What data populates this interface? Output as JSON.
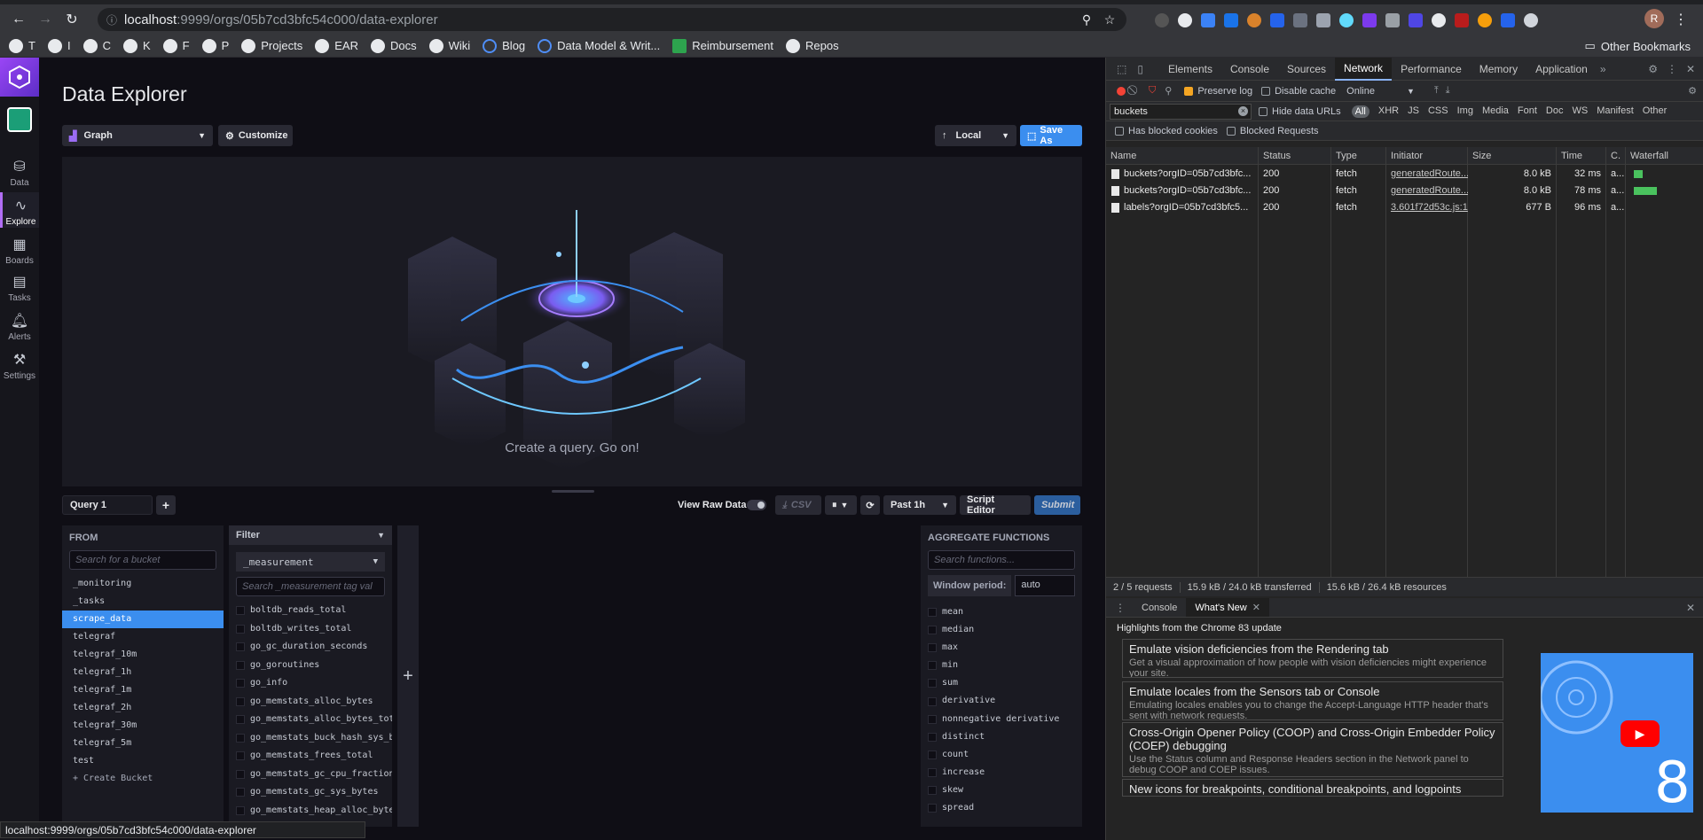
{
  "browser": {
    "url_host": "localhost",
    "url_path": ":9999/orgs/05b7cd3bfc54c000/data-explorer",
    "bookmarks": [
      {
        "label": "T",
        "icon": "github-icon"
      },
      {
        "label": "I",
        "icon": "github-icon"
      },
      {
        "label": "C",
        "icon": "github-icon"
      },
      {
        "label": "K",
        "icon": "github-icon"
      },
      {
        "label": "F",
        "icon": "github-icon"
      },
      {
        "label": "P",
        "icon": "github-icon"
      },
      {
        "label": "Projects",
        "icon": "github-icon"
      },
      {
        "label": "EAR",
        "icon": "github-icon"
      },
      {
        "label": "Docs",
        "icon": "github-icon"
      },
      {
        "label": "Wiki",
        "icon": "wiki-icon"
      },
      {
        "label": "Blog",
        "icon": "globe-icon"
      },
      {
        "label": "Data Model & Writ...",
        "icon": "globe-icon"
      },
      {
        "label": "Reimbursement",
        "icon": "expense-icon"
      },
      {
        "label": "Repos",
        "icon": "github-icon"
      }
    ],
    "other_bookmarks": "Other Bookmarks",
    "profile_initial": "R",
    "status_url": "localhost:9999/orgs/05b7cd3bfc54c000/data-explorer"
  },
  "nav": {
    "items": [
      {
        "label": "Data",
        "icon": "database-icon"
      },
      {
        "label": "Explore",
        "icon": "graph-icon"
      },
      {
        "label": "Boards",
        "icon": "dashboard-icon"
      },
      {
        "label": "Tasks",
        "icon": "calendar-icon"
      },
      {
        "label": "Alerts",
        "icon": "bell-icon"
      },
      {
        "label": "Settings",
        "icon": "wrench-icon"
      }
    ]
  },
  "page": {
    "title": "Data Explorer",
    "graph_type": "Graph",
    "customize": "Customize",
    "timezone": "Local",
    "save_as": "Save As",
    "empty_message": "Create a query. Go on!"
  },
  "query": {
    "tab": "Query 1",
    "add": "+",
    "view_raw": "View Raw Data",
    "csv": "CSV",
    "time_range": "Past 1h",
    "script_editor": "Script Editor",
    "submit": "Submit"
  },
  "from": {
    "header": "FROM",
    "search_placeholder": "Search for a bucket",
    "buckets": [
      "_monitoring",
      "_tasks",
      "scrape_data",
      "telegraf",
      "telegraf_10m",
      "telegraf_1h",
      "telegraf_1m",
      "telegraf_2h",
      "telegraf_30m",
      "telegraf_5m",
      "test"
    ],
    "selected": "scrape_data",
    "create": "+ Create Bucket"
  },
  "filter": {
    "header": "Filter",
    "key": "_measurement",
    "search_placeholder": "Search _measurement tag val",
    "values": [
      "boltdb_reads_total",
      "boltdb_writes_total",
      "go_gc_duration_seconds",
      "go_goroutines",
      "go_info",
      "go_memstats_alloc_bytes",
      "go_memstats_alloc_bytes_total",
      "go_memstats_buck_hash_sys_bytes",
      "go_memstats_frees_total",
      "go_memstats_gc_cpu_fraction",
      "go_memstats_gc_sys_bytes",
      "go_memstats_heap_alloc_bytes"
    ],
    "add": "+"
  },
  "aggregate": {
    "header": "AGGREGATE FUNCTIONS",
    "search_placeholder": "Search functions...",
    "window_label": "Window period:",
    "window_value": "auto",
    "functions": [
      "mean",
      "median",
      "max",
      "min",
      "sum",
      "derivative",
      "nonnegative derivative",
      "distinct",
      "count",
      "increase",
      "skew",
      "spread"
    ]
  },
  "devtools": {
    "tabs": [
      "Elements",
      "Console",
      "Sources",
      "Network",
      "Performance",
      "Memory",
      "Application"
    ],
    "active_tab": "Network",
    "preserve_log": "Preserve log",
    "disable_cache": "Disable cache",
    "throttle": "Online",
    "filter_value": "buckets",
    "hide_data_urls": "Hide data URLs",
    "types": [
      "All",
      "XHR",
      "JS",
      "CSS",
      "Img",
      "Media",
      "Font",
      "Doc",
      "WS",
      "Manifest",
      "Other"
    ],
    "has_blocked": "Has blocked cookies",
    "blocked_requests": "Blocked Requests",
    "columns": [
      "Name",
      "Status",
      "Type",
      "Initiator",
      "Size",
      "Time",
      "C.",
      "Waterfall"
    ],
    "rows": [
      {
        "name": "buckets?orgID=05b7cd3bfc...",
        "status": "200",
        "type": "fetch",
        "initiator": "generatedRoute...",
        "size": "8.0 kB",
        "time": "32 ms",
        "c": "a..."
      },
      {
        "name": "buckets?orgID=05b7cd3bfc...",
        "status": "200",
        "type": "fetch",
        "initiator": "generatedRoute...",
        "size": "8.0 kB",
        "time": "78 ms",
        "c": "a..."
      },
      {
        "name": "labels?orgID=05b7cd3bfc5...",
        "status": "200",
        "type": "fetch",
        "initiator": "3.601f72d53c.js:1",
        "size": "677 B",
        "time": "96 ms",
        "c": "a..."
      }
    ],
    "summary": [
      "2 / 5 requests",
      "15.9 kB / 24.0 kB transferred",
      "15.6 kB / 26.4 kB resources"
    ],
    "drawer_tabs": [
      "Console",
      "What's New"
    ],
    "whats_new_title": "Highlights from the Chrome 83 update",
    "whats_new": [
      {
        "title": "Emulate vision deficiencies from the Rendering tab",
        "desc": "Get a visual approximation of how people with vision deficiencies might experience your site."
      },
      {
        "title": "Emulate locales from the Sensors tab or Console",
        "desc": "Emulating locales enables you to change the Accept-Language HTTP header that's sent with network requests."
      },
      {
        "title": "Cross-Origin Opener Policy (COOP) and Cross-Origin Embedder Policy (COEP) debugging",
        "desc": "Use the Status column and Response Headers section in the Network panel to debug COOP and COEP issues."
      },
      {
        "title": "New icons for breakpoints, conditional breakpoints, and logpoints",
        "desc": ""
      }
    ],
    "video_number": "8"
  }
}
